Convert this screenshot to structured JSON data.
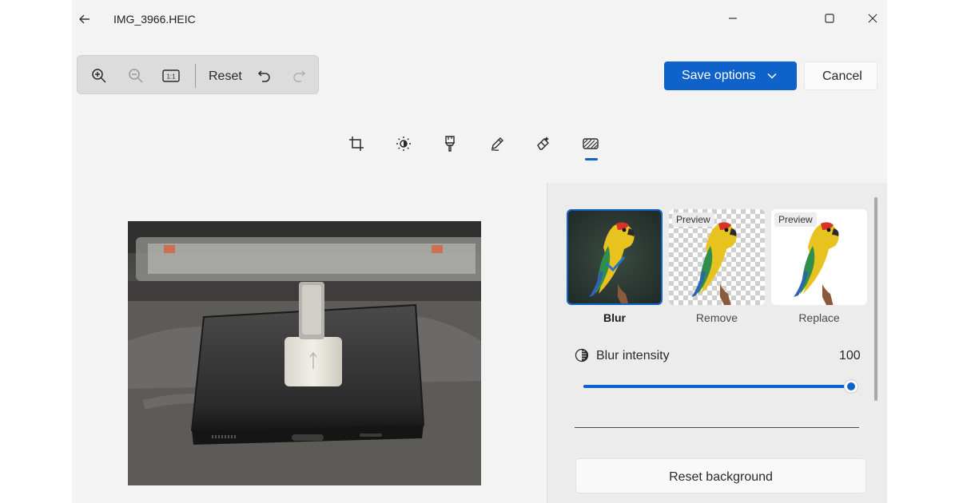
{
  "window": {
    "title": "IMG_3966.HEIC",
    "back_icon": "arrow-left-icon",
    "minimize_icon": "minimize-icon",
    "maximize_icon": "maximize-icon",
    "close_icon": "close-icon"
  },
  "toolbar": {
    "zoom_in_icon": "zoom-in-icon",
    "zoom_out_icon": "zoom-out-icon",
    "actual_size_icon": "actual-size-icon",
    "actual_size_text": "1:1",
    "reset_label": "Reset",
    "undo_icon": "undo-icon",
    "redo_icon": "redo-icon"
  },
  "actions": {
    "save_label": "Save options",
    "cancel_label": "Cancel"
  },
  "tools": [
    {
      "name": "crop",
      "icon": "crop-icon"
    },
    {
      "name": "adjustment",
      "icon": "brightness-icon"
    },
    {
      "name": "filter",
      "icon": "filter-icon"
    },
    {
      "name": "markup",
      "icon": "pen-icon"
    },
    {
      "name": "erase",
      "icon": "eraser-icon"
    },
    {
      "name": "background",
      "icon": "background-icon",
      "selected": true
    }
  ],
  "background_panel": {
    "options": [
      {
        "label": "Blur",
        "selected": true
      },
      {
        "label": "Remove",
        "preview": "Preview"
      },
      {
        "label": "Replace",
        "preview": "Preview"
      }
    ],
    "intensity_label": "Blur intensity",
    "intensity_value": "100",
    "intensity_level": 1.0,
    "reset_label": "Reset background"
  },
  "colors": {
    "accent": "#0f62c9",
    "app_background": "#f3f3f3",
    "panel_background": "#ececec"
  }
}
